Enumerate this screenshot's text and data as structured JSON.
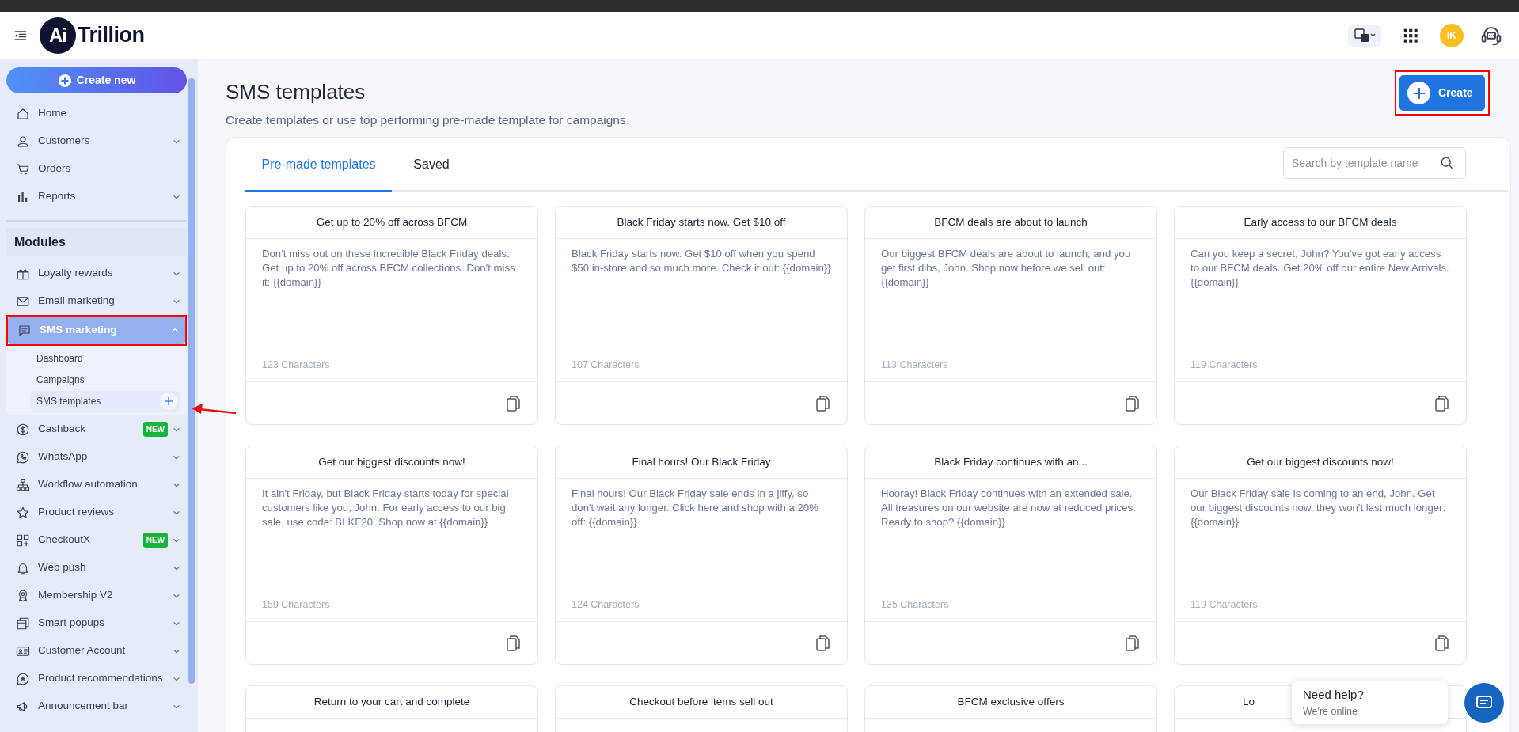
{
  "topbar": {
    "logo_mark": "Ai",
    "logo_text": "Trillion",
    "avatar": "IK"
  },
  "sidebar": {
    "create_button": "Create new",
    "items": [
      {
        "label": "Home",
        "expandable": false
      },
      {
        "label": "Customers",
        "expandable": true
      },
      {
        "label": "Orders",
        "expandable": false
      },
      {
        "label": "Reports",
        "expandable": true
      }
    ],
    "section_title": "Modules",
    "modules": [
      {
        "label": "Loyalty rewards",
        "selected": false,
        "expanded": false
      },
      {
        "label": "Email marketing",
        "selected": false,
        "expanded": false
      },
      {
        "label": "SMS marketing",
        "selected": true,
        "expanded": true,
        "children": [
          {
            "label": "Dashboard",
            "selected": false
          },
          {
            "label": "Campaigns",
            "selected": false
          },
          {
            "label": "SMS templates",
            "selected": true
          }
        ]
      },
      {
        "label": "Cashback",
        "badge": "NEW",
        "selected": false,
        "expanded": false
      },
      {
        "label": "WhatsApp",
        "selected": false,
        "expanded": false
      },
      {
        "label": "Workflow automation",
        "selected": false,
        "expanded": false
      },
      {
        "label": "Product reviews",
        "selected": false,
        "expanded": false
      },
      {
        "label": "CheckoutX",
        "badge": "NEW",
        "selected": false,
        "expanded": false
      },
      {
        "label": "Web push",
        "selected": false,
        "expanded": false
      },
      {
        "label": "Membership V2",
        "selected": false,
        "expanded": false
      },
      {
        "label": "Smart popups",
        "selected": false,
        "expanded": false
      },
      {
        "label": "Customer Account",
        "selected": false,
        "expanded": false
      },
      {
        "label": "Product recommendations",
        "selected": false,
        "expanded": false
      },
      {
        "label": "Announcement bar",
        "selected": false,
        "expanded": false
      }
    ]
  },
  "page": {
    "title": "SMS templates",
    "subtitle": "Create templates or use top performing pre-made template for campaigns.",
    "create_button": "Create"
  },
  "tabs": [
    {
      "label": "Pre-made templates",
      "selected": true
    },
    {
      "label": "Saved",
      "selected": false
    }
  ],
  "search": {
    "placeholder": "Search by template name"
  },
  "templates": [
    {
      "title": "Get up to 20% off across BFCM",
      "text": "Don't miss out on these incredible Black Friday deals. Get up to 20% off across BFCM collections. Don't miss it: {{domain}}",
      "characters": "123 Characters"
    },
    {
      "title": "Black Friday starts now. Get $10 off",
      "text": "Black Friday starts now. Get $10 off when you spend $50 in-store and so much more. Check it out: {{domain}}",
      "characters": "107 Characters"
    },
    {
      "title": "BFCM deals are about to launch",
      "text": "Our biggest BFCM deals are about to launch, and you get first dibs, John. Shop now before we sell out: {{domain}}",
      "characters": "113 Characters"
    },
    {
      "title": "Early access to our BFCM deals",
      "text": "Can you keep a secret, John? You've got early access to our BFCM deals. Get 20% off our entire New Arrivals. {{domain}}",
      "characters": "119 Characters"
    },
    {
      "title": "Get our biggest discounts now!",
      "text": "It ain't Friday, but Black Friday starts today for special customers like you, John. For early access to our big sale, use code: BLKF20. Shop now at {{domain}}",
      "characters": "159 Characters"
    },
    {
      "title": "Final hours! Our Black Friday",
      "text": "Final hours! Our Black Friday sale ends in a jiffy, so don't wait any longer. Click here and shop with a 20% off: {{domain}}",
      "characters": "124 Characters"
    },
    {
      "title": "Black Friday continues with an...",
      "text": "Hooray! Black Friday continues with an extended sale. All treasures on our website are now at reduced prices. Ready to shop? {{domain}}",
      "characters": "135 Characters"
    },
    {
      "title": "Get our biggest discounts now!",
      "text": "Our Black Friday sale is coming to an end, John. Get our biggest discounts now, they won't last much longer: {{domain}}",
      "characters": "119 Characters"
    },
    {
      "title": "Return to your cart and complete"
    },
    {
      "title": "Checkout before items sell out"
    },
    {
      "title": "BFCM exclusive offers"
    },
    {
      "title": "Lo"
    }
  ],
  "chat_widget": {
    "title": "Need help?",
    "status": "We're online"
  }
}
